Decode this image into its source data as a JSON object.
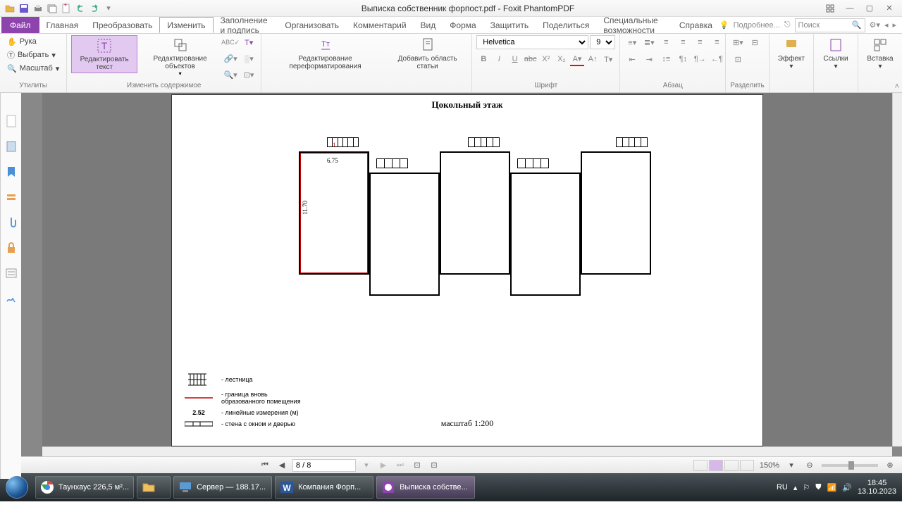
{
  "title": "Выписка собственник форпост.pdf - Foxit PhantomPDF",
  "file_tab": "Файл",
  "tabs": [
    "Главная",
    "Преобразовать",
    "Изменить",
    "Заполнение и подпись",
    "Организовать",
    "Комментарий",
    "Вид",
    "Форма",
    "Защитить",
    "Поделиться",
    "Специальные возможности",
    "Справка"
  ],
  "active_tab": 2,
  "more_link": "Подробнее...",
  "search_placeholder": "Поиск",
  "utilities": {
    "hand": "Рука",
    "select": "Выбрать",
    "zoom": "Масштаб",
    "label": "Утилиты"
  },
  "edit_group": {
    "edit_text": "Редактировать текст",
    "edit_objects": "Редактирование объектов",
    "label": "Изменить содержимое"
  },
  "reflow_group": {
    "reflow": "Редактирование переформатирования",
    "article": "Добавить область статьи"
  },
  "font": {
    "name": "Helvetica",
    "size": "9",
    "label": "Шрифт"
  },
  "para_label": "Абзац",
  "split_label": "Разделить",
  "effect_btn": "Эффект",
  "links_btn": "Ссылки",
  "insert_btn": "Вставка",
  "doc": {
    "floor_title": "Цокольный этаж",
    "room_num": "1",
    "dim_h": "6.75",
    "dim_v": "11.70",
    "scale": "масштаб 1:200",
    "legend": {
      "stairs": "- лестница",
      "boundary": "- граница вновь образованного помещения",
      "dim_sample": "2.52",
      "dims": "- линейные измерения (м)",
      "wall": "- стена с окном и дверью"
    }
  },
  "nav": {
    "page": "8 / 8",
    "zoom": "150%"
  },
  "taskbar": {
    "items": [
      "Таунхаус 226,5 м²...",
      "",
      "Сервер — 188.17...",
      "Компания Форп...",
      "Выписка собстве..."
    ],
    "lang": "RU",
    "time": "18:45",
    "date": "13.10.2023"
  }
}
